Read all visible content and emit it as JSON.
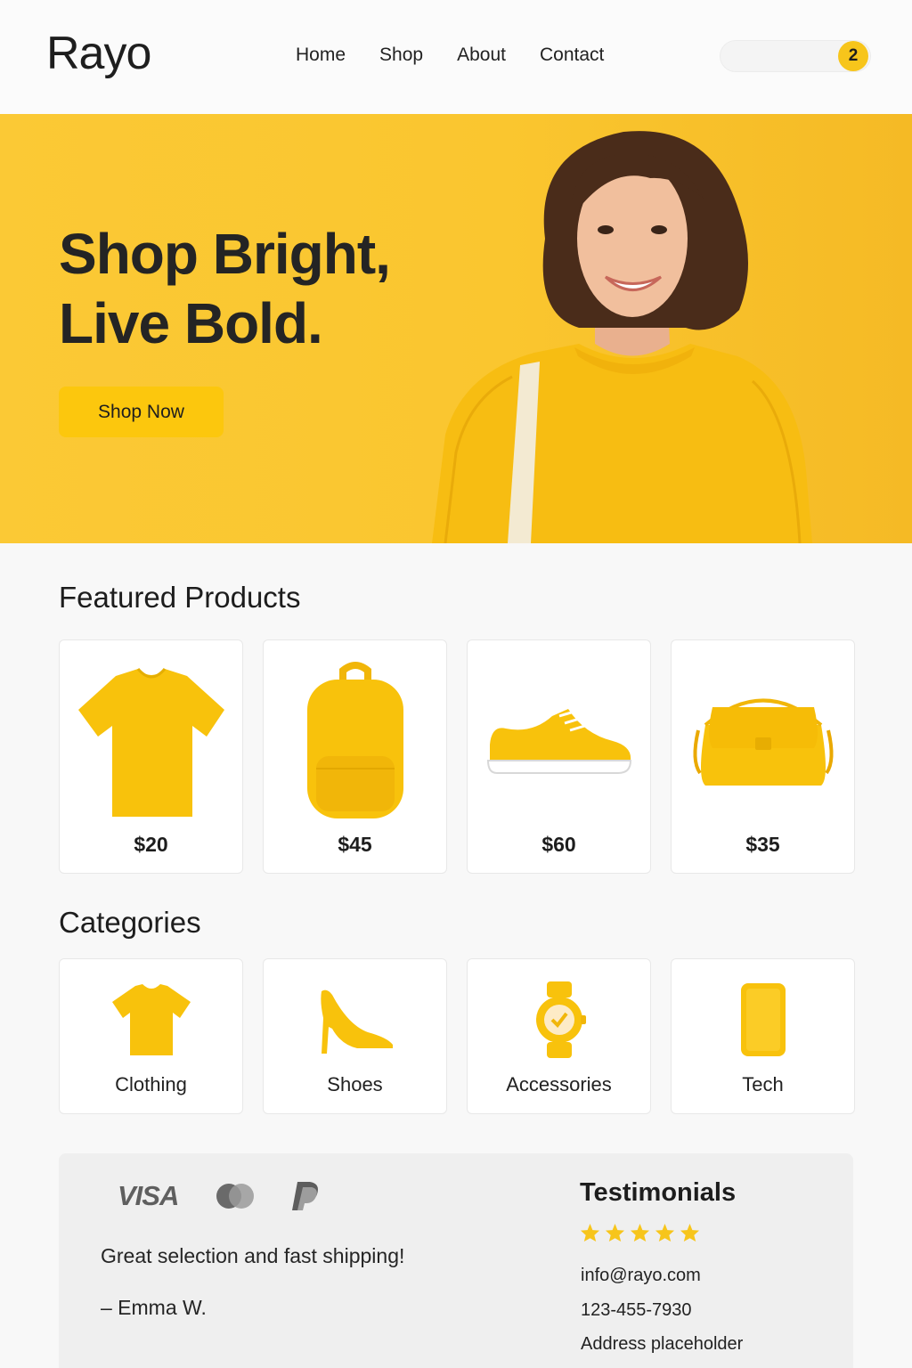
{
  "brand": {
    "logo": "Rayo"
  },
  "nav": {
    "items": [
      "Home",
      "Shop",
      "About",
      "Contact"
    ]
  },
  "cart": {
    "count": "2",
    "icon": "cart-badge"
  },
  "hero": {
    "title_line1": "Shop Bright,",
    "title_line2": "Live Bold.",
    "cta_label": "Shop Now",
    "image": "smiling-woman-yellow-sweater-photo"
  },
  "featured": {
    "title": "Featured Products",
    "products": [
      {
        "icon": "tshirt-icon",
        "price": "$20"
      },
      {
        "icon": "backpack-icon",
        "price": "$45"
      },
      {
        "icon": "sneaker-icon",
        "price": "$60"
      },
      {
        "icon": "handbag-icon",
        "price": "$35"
      }
    ]
  },
  "categories": {
    "title": "Categories",
    "items": [
      {
        "icon": "tshirt-icon",
        "label": "Clothing"
      },
      {
        "icon": "high-heel-icon",
        "label": "Shoes"
      },
      {
        "icon": "watch-icon",
        "label": "Accessories"
      },
      {
        "icon": "phone-icon",
        "label": "Tech"
      }
    ]
  },
  "footer": {
    "payments": [
      "VISA",
      "mastercard-icon",
      "paypal-icon"
    ],
    "quote": "Great selection and fast shipping!",
    "author": "– Emma W.",
    "testimonials_title": "Testimonials",
    "rating": 5,
    "email": "info@rayo.com",
    "phone": "123-455-7930",
    "address": "Address placeholder"
  },
  "colors": {
    "accent": "#f7c51b",
    "hero_bg": "#fbc935",
    "text": "#1d1d1d"
  }
}
